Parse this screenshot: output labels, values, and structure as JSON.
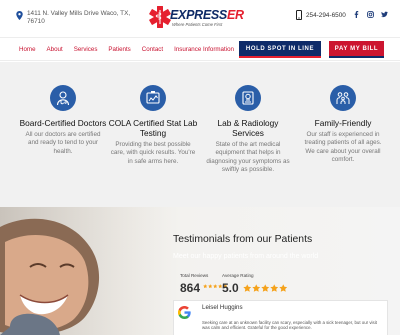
{
  "header": {
    "address": "1411 N. Valley Mills Drive Waco, TX, 76710",
    "logo": {
      "name_main": "EXPRESS",
      "name_accent": "ER",
      "tagline": "Where Patients Come First"
    },
    "phone": "254-294-6500",
    "social": [
      "facebook-icon",
      "instagram-icon",
      "twitter-icon"
    ]
  },
  "nav": {
    "links": [
      "Home",
      "About",
      "Services",
      "Patients",
      "Contact",
      "Insurance Information"
    ],
    "hold_spot": "HOLD SPOT IN LINE",
    "pay_bill": "PAY MY BILL"
  },
  "features": [
    {
      "icon": "doctor-icon",
      "title": "Board-Certified Doctors",
      "text": "All our doctors are certified and ready to tend to your health."
    },
    {
      "icon": "lab-test-icon",
      "title": "COLA Certified Stat Lab Testing",
      "text": "Providing the best possible care, with quick results. You're in safe arms here."
    },
    {
      "icon": "radiology-icon",
      "title": "Lab & Radiology Services",
      "text": "State of the art medical equipment that helps in diagnosing your symptoms as swiftly as possible."
    },
    {
      "icon": "family-icon",
      "title": "Family-Friendly",
      "text": "Our staff is experienced in treating patients of all ages. We care about your overall comfort."
    }
  ],
  "testimonials": {
    "title": "Testimonials from our Patients",
    "subtitle": "Meet our happy patients from around the world",
    "total_reviews_label": "Total Reviews",
    "total_reviews": "864",
    "average_rating_label": "Average Rating",
    "average_rating": "5.0",
    "stars": 5,
    "review": {
      "author": "Leisel Huggins",
      "text": "Seeking care at an unknown facility can scary, especially with a sick teenager, but our visit was calm and efficient. Grateful for the good experience."
    }
  },
  "colors": {
    "brand_red": "#c8102e",
    "brand_navy": "#0e2b69",
    "icon_blue": "#2a5ea8",
    "star_orange": "#f5a21b"
  }
}
